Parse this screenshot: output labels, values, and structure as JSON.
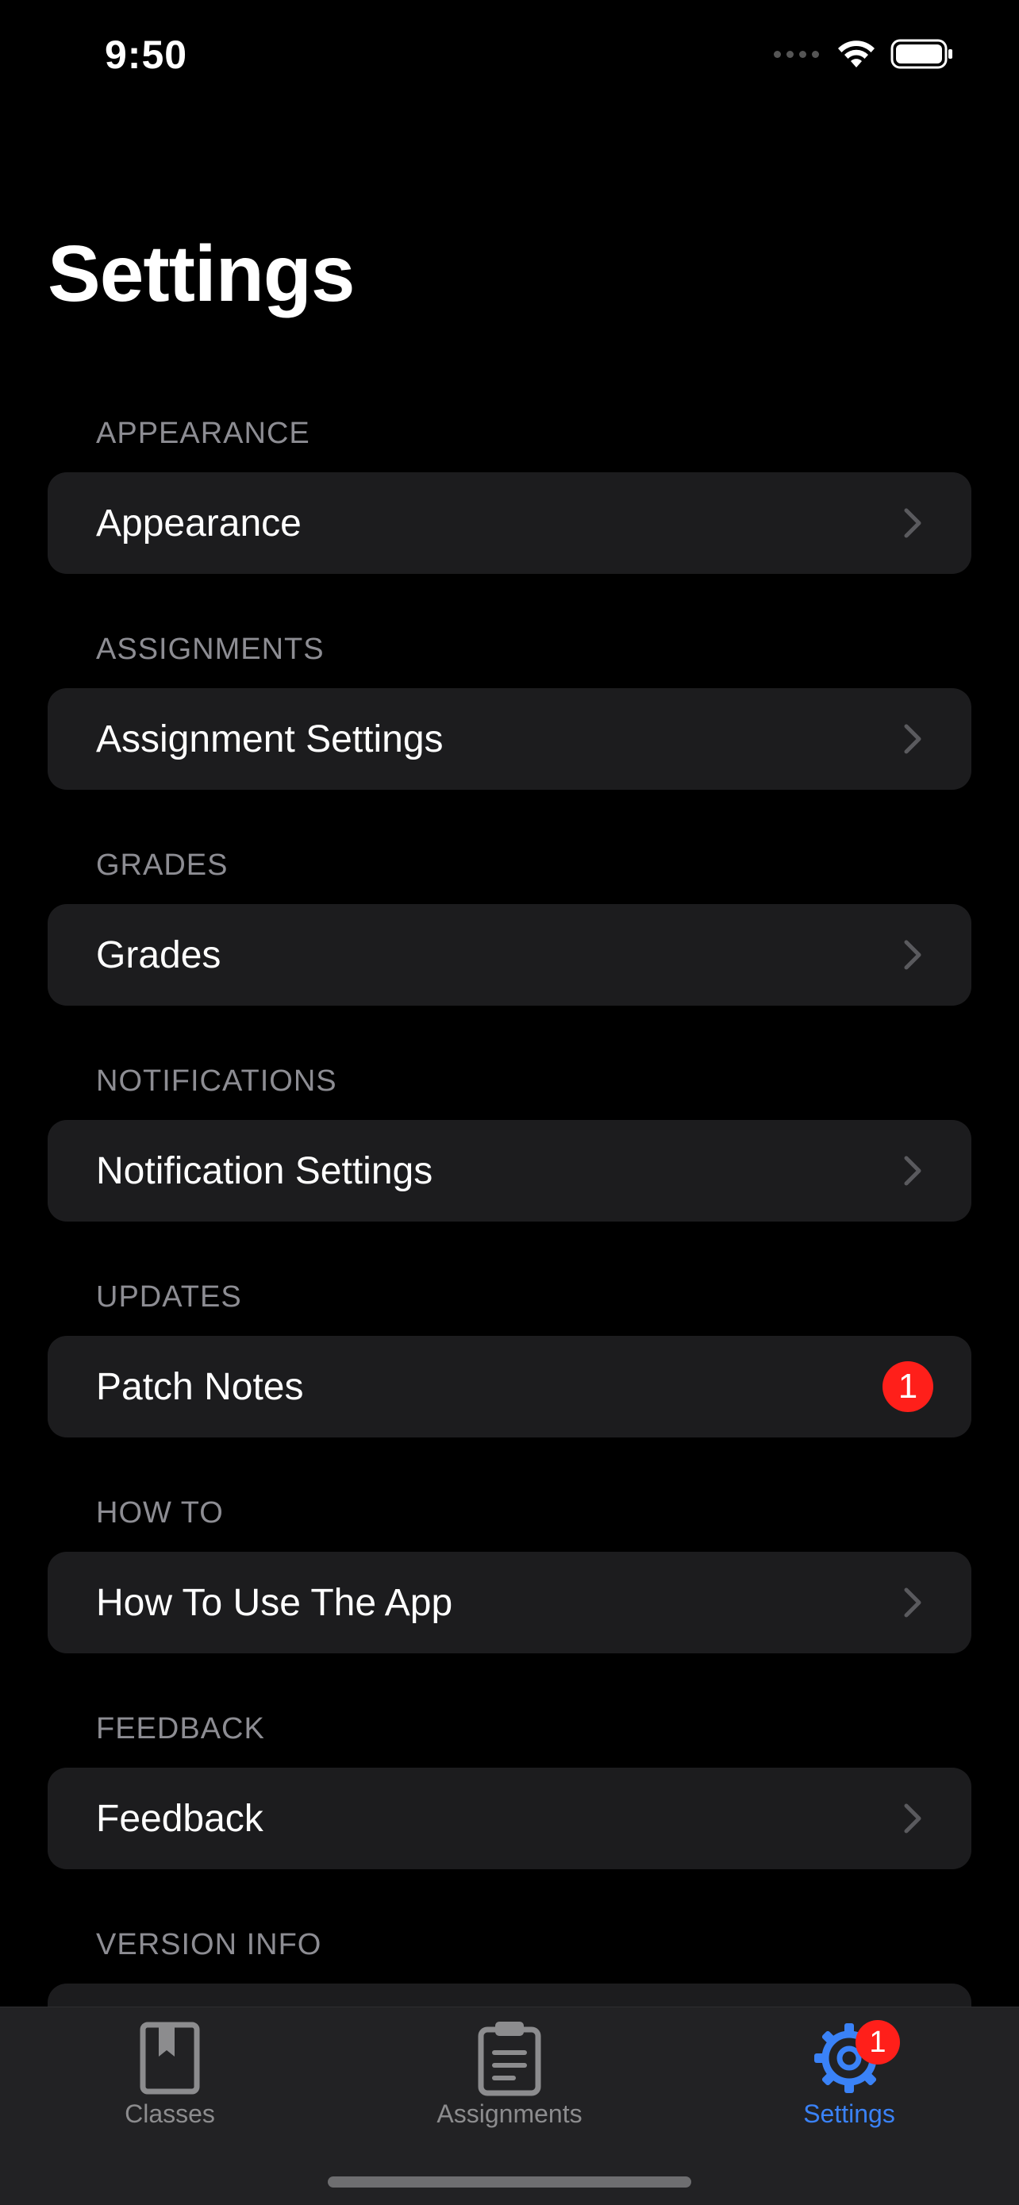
{
  "status_bar": {
    "time": "9:50"
  },
  "title": "Settings",
  "sections": [
    {
      "header": "APPEARANCE",
      "row": {
        "label": "Appearance",
        "accessory": "chevron-right-icon"
      }
    },
    {
      "header": "ASSIGNMENTS",
      "row": {
        "label": "Assignment Settings",
        "accessory": "chevron-right-icon"
      }
    },
    {
      "header": "GRADES",
      "row": {
        "label": "Grades",
        "accessory": "chevron-right-icon"
      }
    },
    {
      "header": "NOTIFICATIONS",
      "row": {
        "label": "Notification Settings",
        "accessory": "chevron-right-icon"
      }
    },
    {
      "header": "UPDATES",
      "row": {
        "label": "Patch Notes",
        "badge": "1"
      }
    },
    {
      "header": "HOW TO",
      "row": {
        "label": "How To Use The App",
        "accessory": "chevron-right-icon"
      }
    },
    {
      "header": "FEEDBACK",
      "row": {
        "label": "Feedback",
        "accessory": "chevron-right-icon"
      }
    },
    {
      "header": "VERSION INFO"
    }
  ],
  "tab_bar": {
    "tabs": [
      {
        "label": "Classes",
        "icon": "book-icon",
        "active": false
      },
      {
        "label": "Assignments",
        "icon": "clipboard-icon",
        "active": false
      },
      {
        "label": "Settings",
        "icon": "gear-icon",
        "active": true,
        "badge": "1"
      }
    ]
  },
  "colors": {
    "background": "#000000",
    "row_background": "#1c1c1e",
    "section_header": "#8d8d93",
    "accent": "#3a82f7",
    "badge": "#ff1f1a",
    "tab_inactive": "#8c8c8e"
  }
}
